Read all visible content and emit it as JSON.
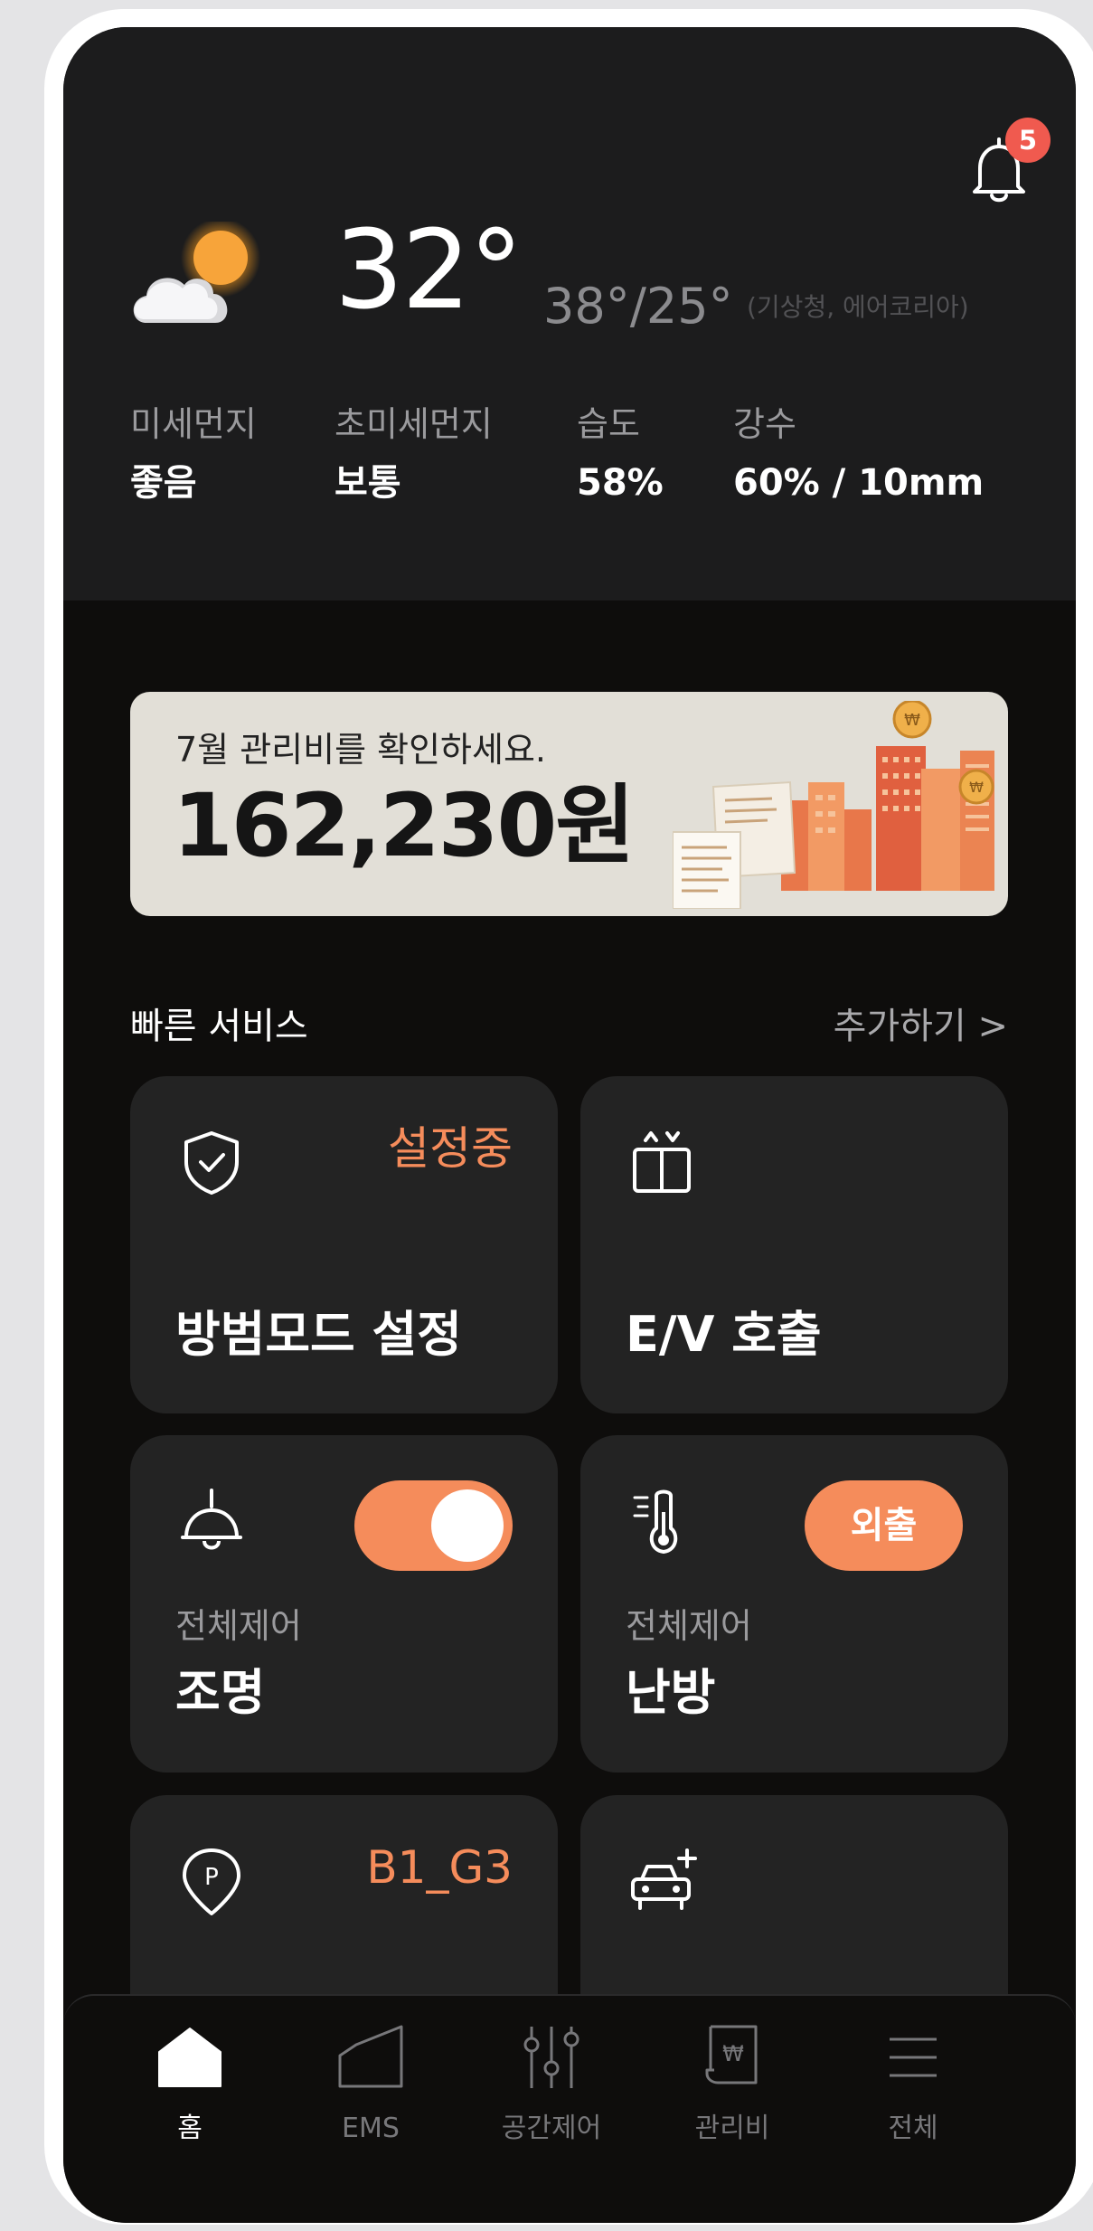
{
  "notifications": {
    "count": "5"
  },
  "weather": {
    "temp": "32°",
    "hilo": "38°/25°",
    "source": "(기상청, 에어코리아)",
    "metrics": [
      {
        "label": "미세먼지",
        "value": "좋음"
      },
      {
        "label": "초미세먼지",
        "value": "보통"
      },
      {
        "label": "습도",
        "value": "58%"
      },
      {
        "label": "강수",
        "value": "60% / 10mm"
      }
    ]
  },
  "bill": {
    "label": "7월 관리비를 확인하세요.",
    "amount": "162,230원"
  },
  "quick_services": {
    "title": "빠른 서비스",
    "add_label": "추가하기 >",
    "cards": [
      {
        "icon": "shield-check-icon",
        "badge": "설정중",
        "title": "방범모드 설정"
      },
      {
        "icon": "elevator-icon",
        "title": "E/V 호출"
      },
      {
        "icon": "lamp-icon",
        "subtitle": "전체제어",
        "title": "조명",
        "toggle_on": true
      },
      {
        "icon": "thermometer-icon",
        "subtitle": "전체제어",
        "title": "난방",
        "pill": "외출"
      },
      {
        "icon": "parking-pin-icon",
        "badge": "B1_G3"
      },
      {
        "icon": "car-add-icon"
      }
    ]
  },
  "tabbar": {
    "tabs": [
      {
        "label": "홈",
        "active": true
      },
      {
        "label": "EMS"
      },
      {
        "label": "공간제어"
      },
      {
        "label": "관리비"
      },
      {
        "label": "전체"
      }
    ]
  },
  "colors": {
    "accent": "#f58c5b",
    "badge_red": "#f05a4f",
    "background": "#0e0d0c",
    "card": "#232323"
  }
}
